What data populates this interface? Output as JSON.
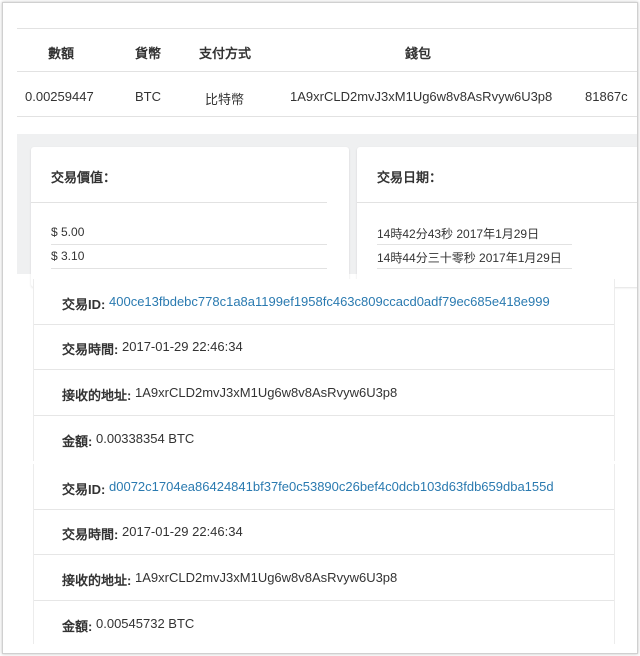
{
  "payment_table": {
    "headers": [
      "數額",
      "貨幣",
      "支付方式",
      "錢包"
    ],
    "row": {
      "amount": "0.00259447",
      "currency": "BTC",
      "method": "比特幣",
      "wallet": "1A9xrCLD2mvJ3xM1Ug6w8v8AsRvyw6U3p8",
      "overflow": "81867c"
    }
  },
  "cards": {
    "value": {
      "title": "交易價值：",
      "items": [
        "$ 5.00",
        "$ 3.10"
      ]
    },
    "date": {
      "title": "交易日期：",
      "items": [
        "14時42分43秒 2017年1月29日",
        "14時44分三十零秒 2017年1月29日"
      ]
    }
  },
  "transactions": [
    {
      "id_label": "交易ID:",
      "id": "400ce13fbdebc778c1a8a1199ef1958fc463c809ccacd0adf79ec685e418e999",
      "time_label": "交易時間:",
      "time": "2017-01-29 22:46:34",
      "addr_label": "接收的地址:",
      "addr": "1A9xrCLD2mvJ3xM1Ug6w8v8AsRvyw6U3p8",
      "amount_label": "金額:",
      "amount": "0.00338354 BTC"
    },
    {
      "id_label": "交易ID:",
      "id": "d0072c1704ea86424841bf37fe0c53890c26bef4c0dcb103d63fdb659dba155d",
      "time_label": "交易時間:",
      "time": "2017-01-29 22:46:34",
      "addr_label": "接收的地址:",
      "addr": "1A9xrCLD2mvJ3xM1Ug6w8v8AsRvyw6U3p8",
      "amount_label": "金額:",
      "amount": "0.00545732 BTC"
    }
  ],
  "colors": {
    "link": "#2a7ab0",
    "band": "#eff0f1",
    "divider": "#e2e2e2"
  }
}
